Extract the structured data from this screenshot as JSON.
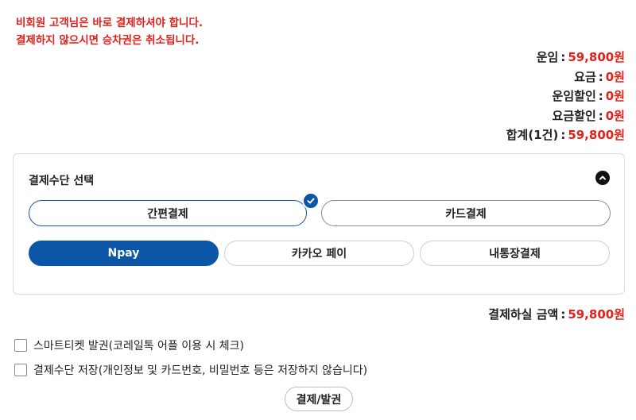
{
  "notice": {
    "line1": "비회원 고객님은 바로 결제하셔야 합니다.",
    "line2": "결제하지 않으시면 승차권은 취소됩니다."
  },
  "summary": [
    {
      "label": "운임",
      "value": "59,800원"
    },
    {
      "label": "요금",
      "value": "0원"
    },
    {
      "label": "운임할인",
      "value": "0원"
    },
    {
      "label": "요금할인",
      "value": "0원"
    },
    {
      "label": "합계(1건)",
      "value": "59,800원"
    }
  ],
  "separator": ":",
  "payment": {
    "title": "결제수단 선택",
    "methods": [
      {
        "label": "간편결제",
        "selected": true
      },
      {
        "label": "카드결제",
        "selected": false
      }
    ],
    "sub_methods": [
      {
        "label": "Npay",
        "selected": true
      },
      {
        "label": "카카오 페이",
        "selected": false
      },
      {
        "label": "내통장결제",
        "selected": false
      }
    ]
  },
  "total": {
    "label": "결제하실 금액",
    "value": "59,800원"
  },
  "options": [
    {
      "label": "스마트티켓 발권(코레일톡 어플 이용 시 체크)",
      "checked": false
    },
    {
      "label": "결제수단 저장(개인정보 및 카드번호, 비밀번호 등은 저장하지 않습니다)",
      "checked": false
    }
  ],
  "submit_label": "결제/발권",
  "colors": {
    "accent": "#0b56a7",
    "price": "#e0221b"
  },
  "icons": {
    "collapse": "chevron-up-icon",
    "selected": "check-icon"
  }
}
